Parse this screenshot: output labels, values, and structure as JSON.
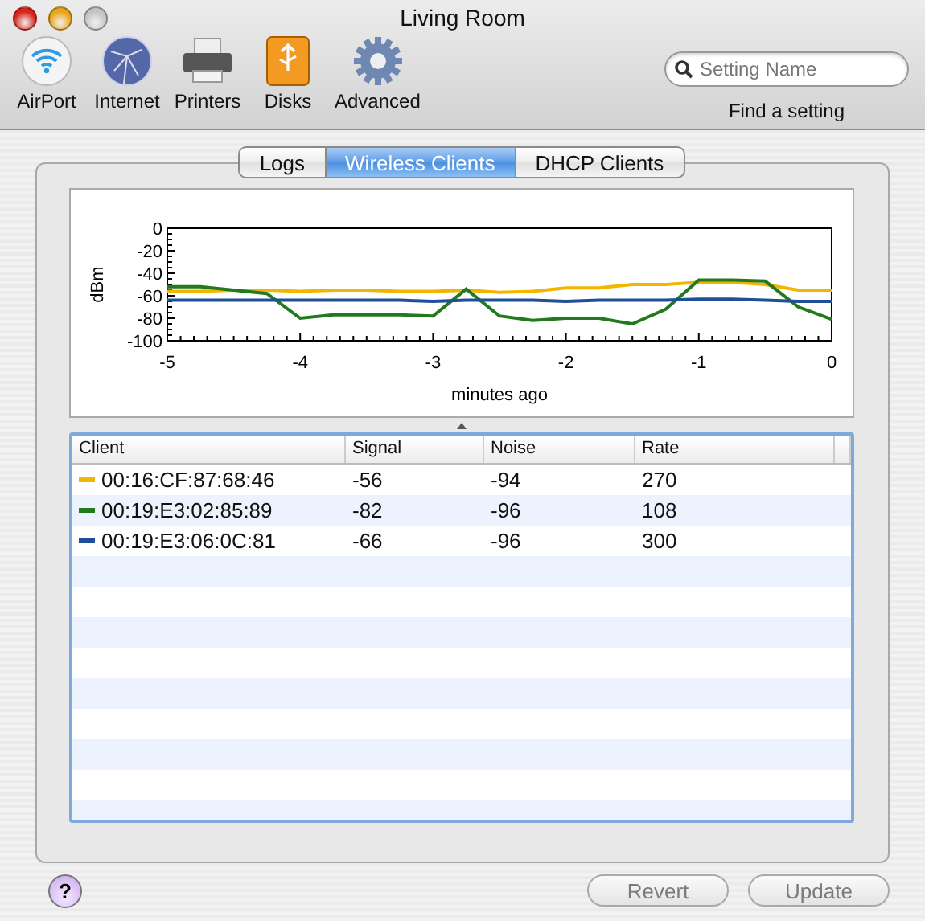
{
  "window": {
    "title": "Living Room"
  },
  "toolbar": [
    {
      "kind": "wifi",
      "label": "AirPort"
    },
    {
      "kind": "globe",
      "label": "Internet"
    },
    {
      "kind": "printer",
      "label": "Printers"
    },
    {
      "kind": "disk",
      "label": "Disks"
    },
    {
      "kind": "gear",
      "label": "Advanced"
    }
  ],
  "search": {
    "placeholder": "Setting Name",
    "caption": "Find a setting"
  },
  "tabs": [
    {
      "label": "Logs",
      "selected": false
    },
    {
      "label": "Wireless Clients",
      "selected": true
    },
    {
      "label": "DHCP Clients",
      "selected": false
    }
  ],
  "chart_data": {
    "type": "line",
    "xlabel": "minutes ago",
    "ylabel": "dBm",
    "x": [
      -5,
      -4.75,
      -4.5,
      -4.25,
      -4,
      -3.75,
      -3.5,
      -3.25,
      -3,
      -2.75,
      -2.5,
      -2.25,
      -2,
      -1.75,
      -1.5,
      -1.25,
      -1,
      -0.75,
      -0.5,
      -0.25,
      0
    ],
    "xlim": [
      -5,
      0
    ],
    "ylim": [
      -100,
      0
    ],
    "xticks": [
      -5,
      -4,
      -3,
      -2,
      -1,
      0
    ],
    "yticks": [
      0,
      -20,
      -40,
      -60,
      -80,
      -100
    ],
    "series": [
      {
        "color": "#f2b600",
        "values": [
          -56,
          -56,
          -55,
          -55,
          -56,
          -55,
          -55,
          -56,
          -56,
          -55,
          -57,
          -56,
          -53,
          -53,
          -50,
          -50,
          -48,
          -48,
          -50,
          -55,
          -55
        ]
      },
      {
        "color": "#237a1c",
        "values": [
          -52,
          -52,
          -55,
          -58,
          -80,
          -77,
          -77,
          -77,
          -78,
          -54,
          -78,
          -82,
          -80,
          -80,
          -85,
          -72,
          -46,
          -46,
          -47,
          -70,
          -81
        ]
      },
      {
        "color": "#1f4f96",
        "values": [
          -64,
          -64,
          -64,
          -64,
          -64,
          -64,
          -64,
          -64,
          -65,
          -64,
          -64,
          -64,
          -65,
          -64,
          -64,
          -64,
          -63,
          -63,
          -64,
          -65,
          -65
        ]
      }
    ]
  },
  "table": {
    "columns": [
      "Client",
      "Signal",
      "Noise",
      "Rate"
    ],
    "rows": [
      {
        "client": "00:16:CF:87:68:46",
        "color": "#f2b600",
        "signal": "-56",
        "noise": "-94",
        "rate": "270"
      },
      {
        "client": "00:19:E3:02:85:89",
        "color": "#237a1c",
        "signal": "-82",
        "noise": "-96",
        "rate": "108"
      },
      {
        "client": "00:19:E3:06:0C:81",
        "color": "#1f4f96",
        "signal": "-66",
        "noise": "-96",
        "rate": "300"
      }
    ]
  },
  "help": "?",
  "buttons": [
    {
      "label": "Revert",
      "disabled": true
    },
    {
      "label": "Update",
      "disabled": true
    }
  ]
}
